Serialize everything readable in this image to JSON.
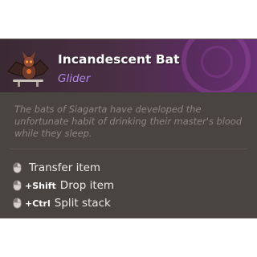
{
  "item": {
    "name": "Incandescent Bat",
    "type": "Glider",
    "description": "The bats of Siagarta have developed the unfortunate habit of drinking their master's blood while they sleep.",
    "icon": "bat-glider-icon",
    "type_color": "#b488e8"
  },
  "actions": [
    {
      "modifier": "",
      "label": "Transfer item",
      "icon": "mouse-click-icon"
    },
    {
      "modifier": "+Shift",
      "label": "Drop item",
      "icon": "mouse-click-icon"
    },
    {
      "modifier": "+Ctrl",
      "label": "Split stack",
      "icon": "mouse-click-icon"
    }
  ],
  "colors": {
    "panel_bg": "#4a4440",
    "header_accent": "#6a2f74",
    "flavor_text": "#8c857e",
    "action_text": "#ece8e4"
  }
}
